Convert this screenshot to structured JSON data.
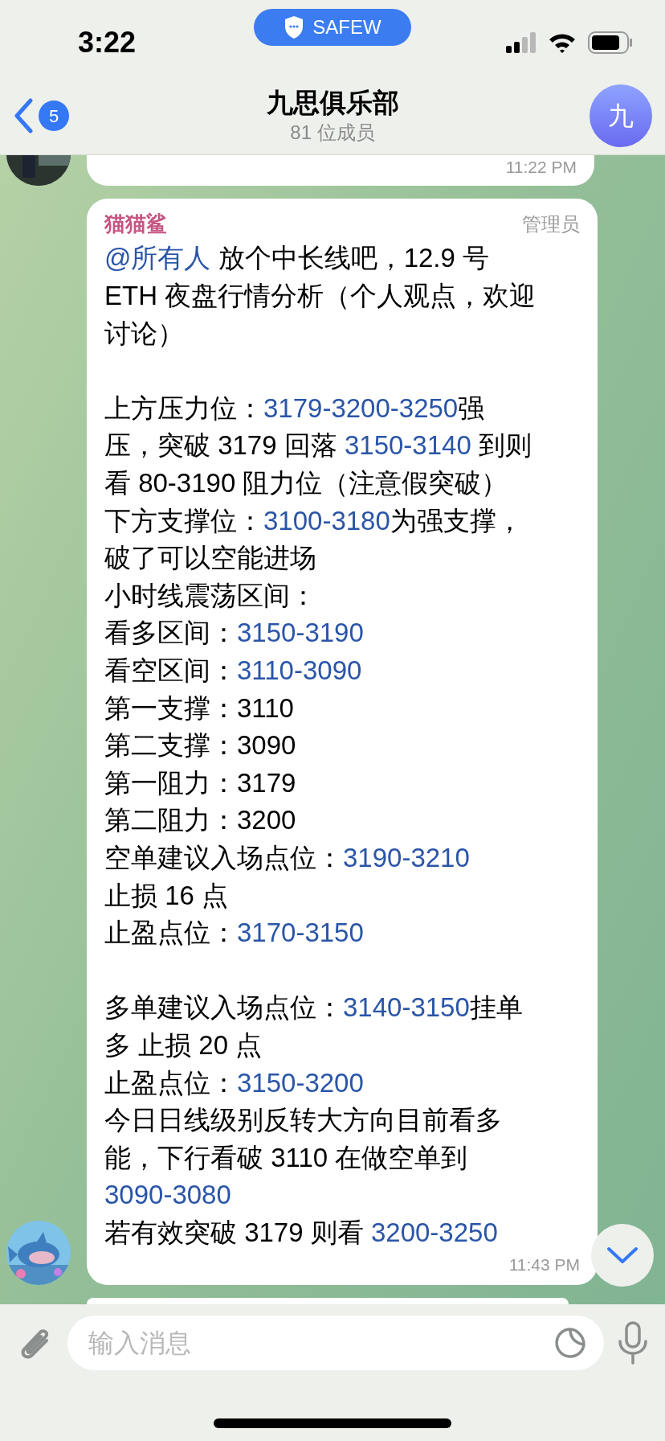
{
  "status_bar": {
    "time": "3:22",
    "pill": "SAFEW"
  },
  "header": {
    "back_badge": "5",
    "title": "九思俱乐部",
    "subtitle": "81 位成员",
    "avatar_letter": "九"
  },
  "messages": [
    {
      "kind": "partial",
      "time": "11:22 PM"
    },
    {
      "kind": "full",
      "sender": "猫猫鲨",
      "role": "管理员",
      "time": "11:43 PM",
      "paragraphs": [
        [
          [
            {
              "t": "@所有人",
              "link": true
            },
            {
              "t": " 放个中长线吧，12.9 号",
              "link": false
            }
          ],
          [
            {
              "t": "ETH 夜盘行情分析（个人观点，欢迎",
              "link": false
            }
          ],
          [
            {
              "t": "讨论）",
              "link": false
            }
          ]
        ],
        [
          [
            {
              "t": "上方压力位：",
              "link": false
            },
            {
              "t": "3179-3200-3250",
              "link": true
            },
            {
              "t": "强",
              "link": false
            }
          ],
          [
            {
              "t": "压，突破 3179 回落 ",
              "link": false
            },
            {
              "t": "3150-3140",
              "link": true
            },
            {
              "t": " 到则",
              "link": false
            }
          ],
          [
            {
              "t": "看 80-3190 阻力位（注意假突破）",
              "link": false
            }
          ],
          [
            {
              "t": "下方支撑位：",
              "link": false
            },
            {
              "t": "3100-3180",
              "link": true
            },
            {
              "t": "为强支撑，",
              "link": false
            }
          ],
          [
            {
              "t": "破了可以空能进场",
              "link": false
            }
          ],
          [
            {
              "t": "小时线震荡区间：",
              "link": false
            }
          ],
          [
            {
              "t": "看多区间：",
              "link": false
            },
            {
              "t": "3150-3190",
              "link": true
            }
          ],
          [
            {
              "t": "看空区间：",
              "link": false
            },
            {
              "t": "3110-3090",
              "link": true
            }
          ],
          [
            {
              "t": "第一支撑：3110",
              "link": false
            }
          ],
          [
            {
              "t": "第二支撑：3090",
              "link": false
            }
          ],
          [
            {
              "t": "第一阻力：3179",
              "link": false
            }
          ],
          [
            {
              "t": "第二阻力：3200",
              "link": false
            }
          ],
          [
            {
              "t": "空单建议入场点位：",
              "link": false
            },
            {
              "t": "3190-3210",
              "link": true
            }
          ],
          [
            {
              "t": "止损 16 点",
              "link": false
            }
          ],
          [
            {
              "t": "止盈点位：",
              "link": false
            },
            {
              "t": "3170-3150",
              "link": true
            }
          ]
        ],
        [
          [
            {
              "t": "多单建议入场点位：",
              "link": false
            },
            {
              "t": "3140-3150",
              "link": true
            },
            {
              "t": "挂单",
              "link": false
            }
          ],
          [
            {
              "t": "多 止损 20 点",
              "link": false
            }
          ],
          [
            {
              "t": "止盈点位：",
              "link": false
            },
            {
              "t": "3150-3200",
              "link": true
            }
          ],
          [
            {
              "t": "今日日线级别反转大方向目前看多",
              "link": false
            }
          ],
          [
            {
              "t": "能，下行看破 3110 在做空单到",
              "link": false
            }
          ],
          [
            {
              "t": "3090-3080",
              "link": true
            }
          ],
          [
            {
              "t": "若有效突破 3179 则看 ",
              "link": false
            },
            {
              "t": "3200-3250",
              "link": true
            }
          ]
        ]
      ]
    }
  ],
  "input": {
    "placeholder": "输入消息"
  }
}
